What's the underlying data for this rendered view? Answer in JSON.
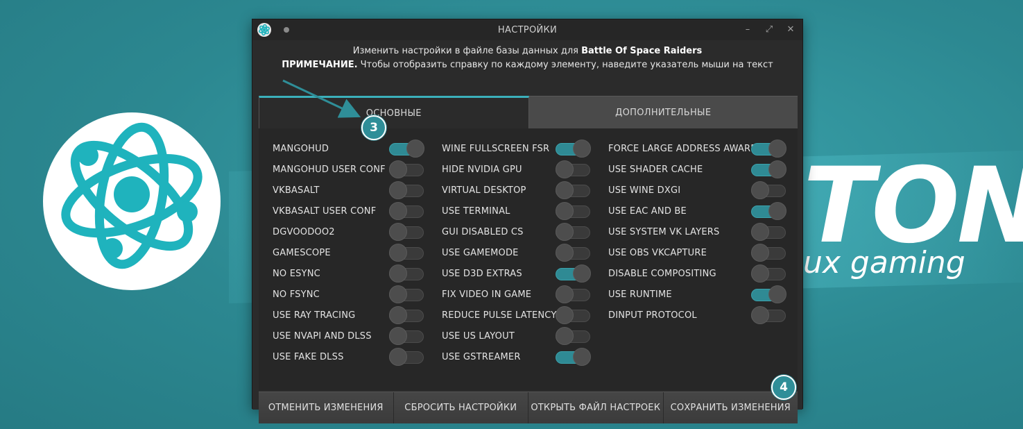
{
  "background": {
    "brand_text": "TON",
    "tagline": "ux gaming",
    "logo_icon": "atom-logo-icon",
    "color": "#2e8a93"
  },
  "window": {
    "title": "НАСТРОЙКИ",
    "app_icon": "atom-app-icon",
    "controls": {
      "minimize": "–",
      "maximize": "⤢",
      "close": "✕"
    }
  },
  "info": {
    "line1_prefix": "Изменить настройки в файле базы данных для ",
    "game_name": "Battle Of Space Raiders",
    "note_label": "ПРИМЕЧАНИЕ.",
    "note_text": " Чтобы отобразить справку по каждому элементу, наведите указатель мыши на текст"
  },
  "tabs": [
    {
      "label": "ОСНОВНЫЕ",
      "active": true
    },
    {
      "label": "ДОПОЛНИТЕЛЬНЫЕ",
      "active": false
    }
  ],
  "columns": [
    [
      {
        "label": "MANGOHUD",
        "on": true
      },
      {
        "label": "MANGOHUD USER CONF",
        "on": false
      },
      {
        "label": "VKBASALT",
        "on": false
      },
      {
        "label": "VKBASALT USER CONF",
        "on": false
      },
      {
        "label": "DGVOODOO2",
        "on": false
      },
      {
        "label": "GAMESCOPE",
        "on": false
      },
      {
        "label": "NO ESYNC",
        "on": false
      },
      {
        "label": "NO FSYNC",
        "on": false
      },
      {
        "label": "USE RAY TRACING",
        "on": false
      },
      {
        "label": "USE NVAPI AND DLSS",
        "on": false
      },
      {
        "label": "USE FAKE DLSS",
        "on": false
      }
    ],
    [
      {
        "label": "WINE FULLSCREEN FSR",
        "on": true
      },
      {
        "label": "HIDE NVIDIA GPU",
        "on": false
      },
      {
        "label": "VIRTUAL DESKTOP",
        "on": false
      },
      {
        "label": "USE TERMINAL",
        "on": false
      },
      {
        "label": "GUI DISABLED CS",
        "on": false
      },
      {
        "label": "USE GAMEMODE",
        "on": false
      },
      {
        "label": "USE D3D EXTRAS",
        "on": true
      },
      {
        "label": "FIX VIDEO IN GAME",
        "on": false
      },
      {
        "label": "REDUCE PULSE LATENCY",
        "on": false
      },
      {
        "label": "USE US LAYOUT",
        "on": false
      },
      {
        "label": "USE GSTREAMER",
        "on": true
      }
    ],
    [
      {
        "label": "FORCE LARGE ADDRESS AWARE",
        "on": true
      },
      {
        "label": "USE SHADER CACHE",
        "on": true
      },
      {
        "label": "USE WINE DXGI",
        "on": false
      },
      {
        "label": "USE EAC AND BE",
        "on": true
      },
      {
        "label": "USE SYSTEM VK LAYERS",
        "on": false
      },
      {
        "label": "USE OBS VKCAPTURE",
        "on": false
      },
      {
        "label": "DISABLE COMPOSITING",
        "on": false
      },
      {
        "label": "USE RUNTIME",
        "on": true
      },
      {
        "label": "DINPUT PROTOCOL",
        "on": false
      }
    ]
  ],
  "footer": {
    "cancel": "ОТМЕНИТЬ ИЗМЕНЕНИЯ",
    "reset": "СБРОСИТЬ НАСТРОЙКИ",
    "open_file": "ОТКРЫТЬ ФАЙЛ НАСТРОЕК",
    "save": "СОХРАНИТЬ ИЗМЕНЕНИЯ"
  },
  "callouts": {
    "first": "3",
    "second": "4"
  },
  "accent_color": "#3bb0bb"
}
